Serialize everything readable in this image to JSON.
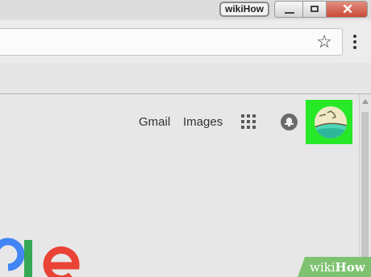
{
  "window": {
    "profile_label": "wikiHow",
    "close_symbol": "✕"
  },
  "toolbar": {
    "bookmark_icon": "star-outline",
    "menu_icon": "vertical-dots"
  },
  "header": {
    "links": [
      "Gmail",
      "Images"
    ],
    "apps_icon": "grid-9",
    "notifications_icon": "bell",
    "avatar_icon": "beach-illustration",
    "highlight_color": "#27e827"
  },
  "logo": {
    "colors": [
      "#4285f4",
      "#34a853",
      "#ea4335"
    ]
  },
  "watermark": {
    "prefix": "wiki",
    "brand": "How",
    "color": "#7ec270"
  }
}
